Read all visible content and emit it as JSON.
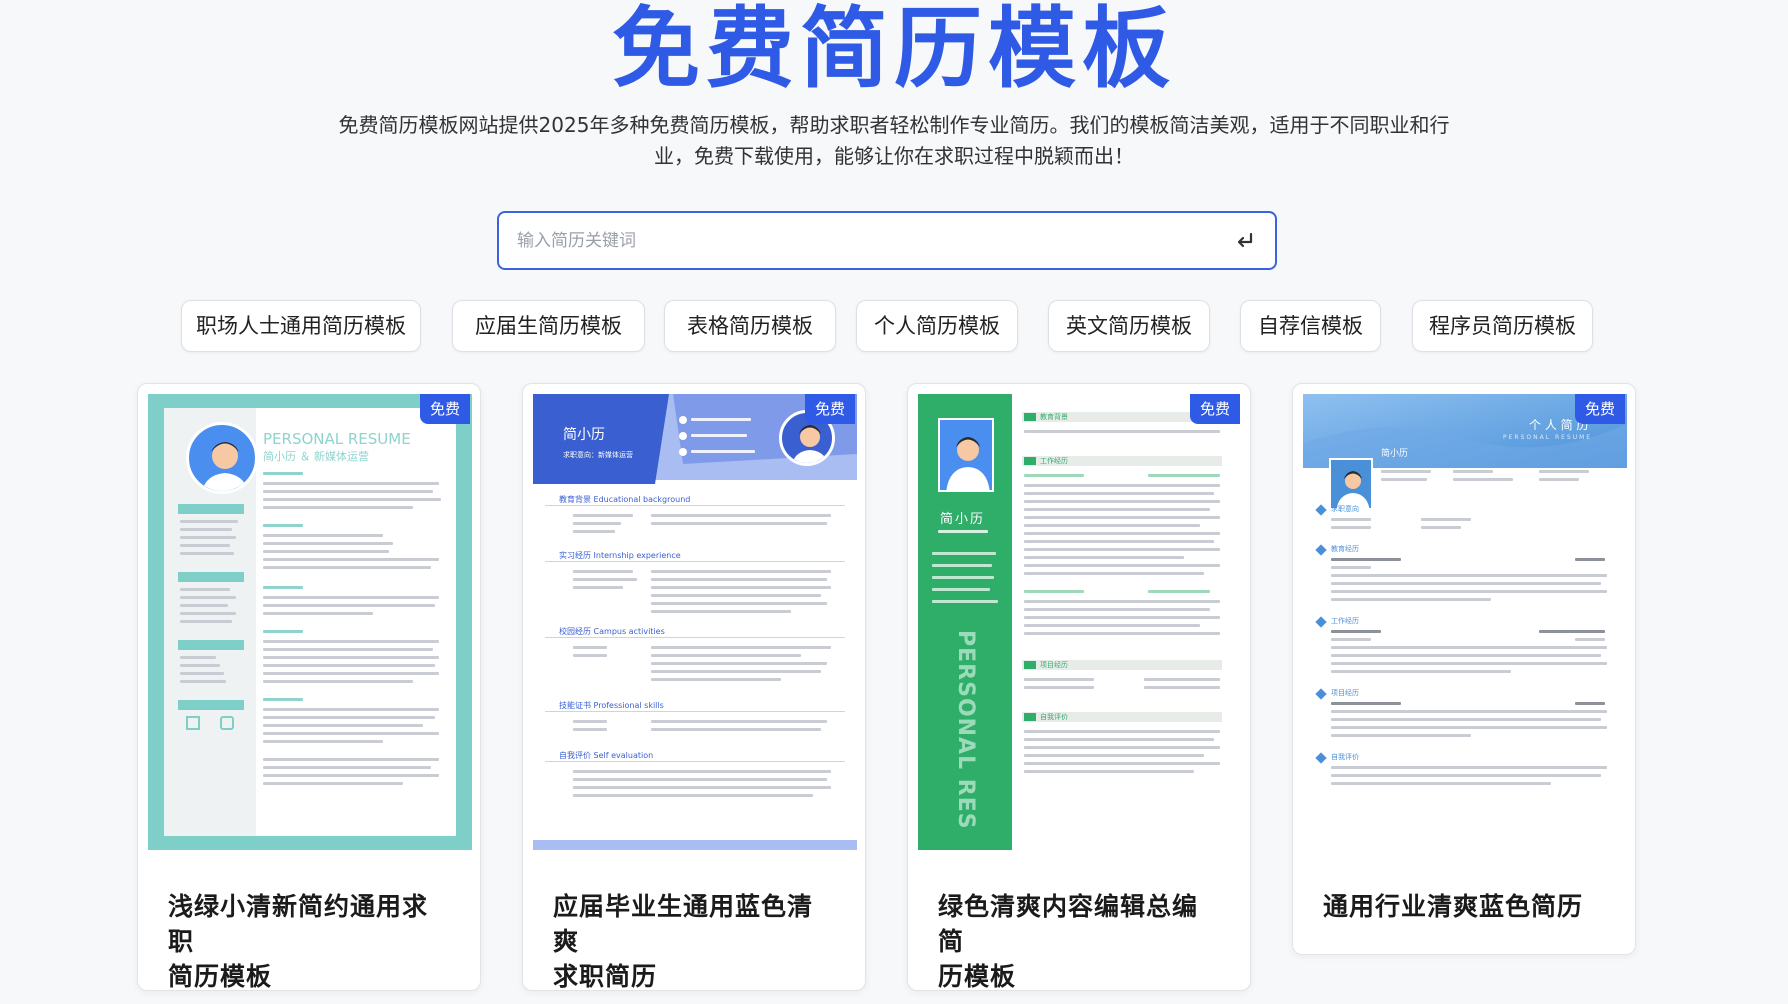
{
  "hero": {
    "title": "免费简历模板",
    "description_line1": "免费简历模板网站提供2025年多种免费简历模板，帮助求职者轻松制作专业简历。我们的模板简洁美观，适用于不同职业和行",
    "description_line2": "业，免费下载使用，能够让你在求职过程中脱颖而出！"
  },
  "search": {
    "placeholder": "输入简历关键词",
    "value": "",
    "submit_icon": "enter-return-icon"
  },
  "tags": [
    "职场人士通用简历模板",
    "应届生简历模板",
    "表格简历模板",
    "个人简历模板",
    "英文简历模板",
    "自荐信模板",
    "程序员简历模板"
  ],
  "cards": [
    {
      "badge": "免费",
      "title_line1": "浅绿小清新简约通用求职",
      "title_line2": "简历模板",
      "preview": {
        "heading": "PERSONAL RESUME",
        "subheading": "简小历 ＆ 新媒体运营"
      }
    },
    {
      "badge": "免费",
      "title_line1": "应届毕业生通用蓝色清爽",
      "title_line2": "求职简历",
      "preview": {
        "name": "简小历",
        "role": "求职意向：新媒体运营",
        "sections": [
          "教育背景 Educational background",
          "实习经历 Internship experience",
          "校园经历 Campus activities",
          "技能证书 Professional skills",
          "自我评价 Self evaluation"
        ]
      }
    },
    {
      "badge": "免费",
      "title_line1": "绿色清爽内容编辑总编简",
      "title_line2": "历模板",
      "preview": {
        "name": "简小历",
        "vertical_text": "PERSONAL RESUME",
        "sections": [
          "教育背景",
          "工作经历",
          "项目经历",
          "自我评价"
        ]
      }
    },
    {
      "badge": "免费",
      "title_line1": "通用行业清爽蓝色简历",
      "title_line2": "",
      "preview": {
        "heading": "个 人 简 历",
        "subheading": "PERSONAL RESUME",
        "name": "简小历",
        "sections": [
          "求职意向",
          "教育经历",
          "工作经历",
          "项目经历",
          "自我评价"
        ]
      }
    }
  ],
  "colors": {
    "brand_blue": "#2f5ae6",
    "mint": "#7fcfc9",
    "card1_heading": "#8fd3cd",
    "card2_blue": "#3a5fd0",
    "card3_green": "#2fae6a",
    "card4_blue": "#4a90d9"
  }
}
